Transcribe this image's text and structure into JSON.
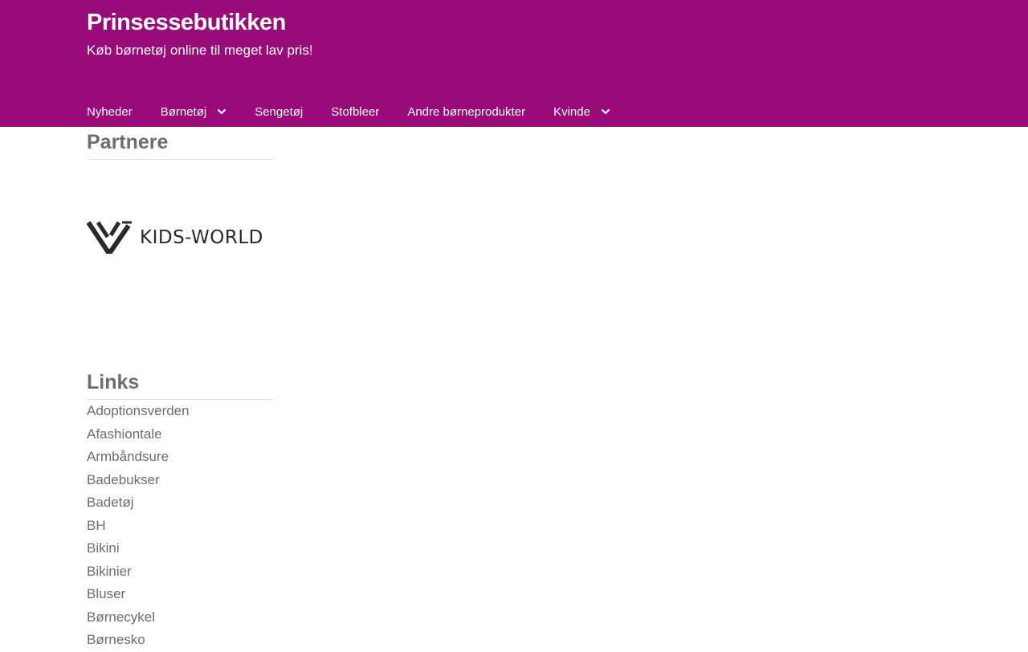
{
  "site": {
    "title": "Prinsessebutikken",
    "tagline": "Køb børnetøj online til meget lav pris!"
  },
  "nav": {
    "items": [
      {
        "label": "Nyheder",
        "has_dropdown": false
      },
      {
        "label": "Børnetøj",
        "has_dropdown": true
      },
      {
        "label": "Sengetøj",
        "has_dropdown": false
      },
      {
        "label": "Stofbleer",
        "has_dropdown": false
      },
      {
        "label": "Andre børneprodukter",
        "has_dropdown": false
      },
      {
        "label": "Kvinde",
        "has_dropdown": true
      }
    ]
  },
  "sidebar": {
    "partners_title": "Partnere",
    "partner_logo_text": "KIDS-WORLD",
    "links_title": "Links",
    "links": [
      "Adoptionsverden",
      "Afashiontale",
      "Armbåndsure",
      "Badebukser",
      "Badetøj",
      "BH",
      "Bikini",
      "Bikinier",
      "Bluser",
      "Børnecykel",
      "Børnesko"
    ]
  },
  "colors": {
    "header_bg": "#9a0b7a",
    "header_text": "#ffffff",
    "body_text": "#6d6d6d"
  }
}
